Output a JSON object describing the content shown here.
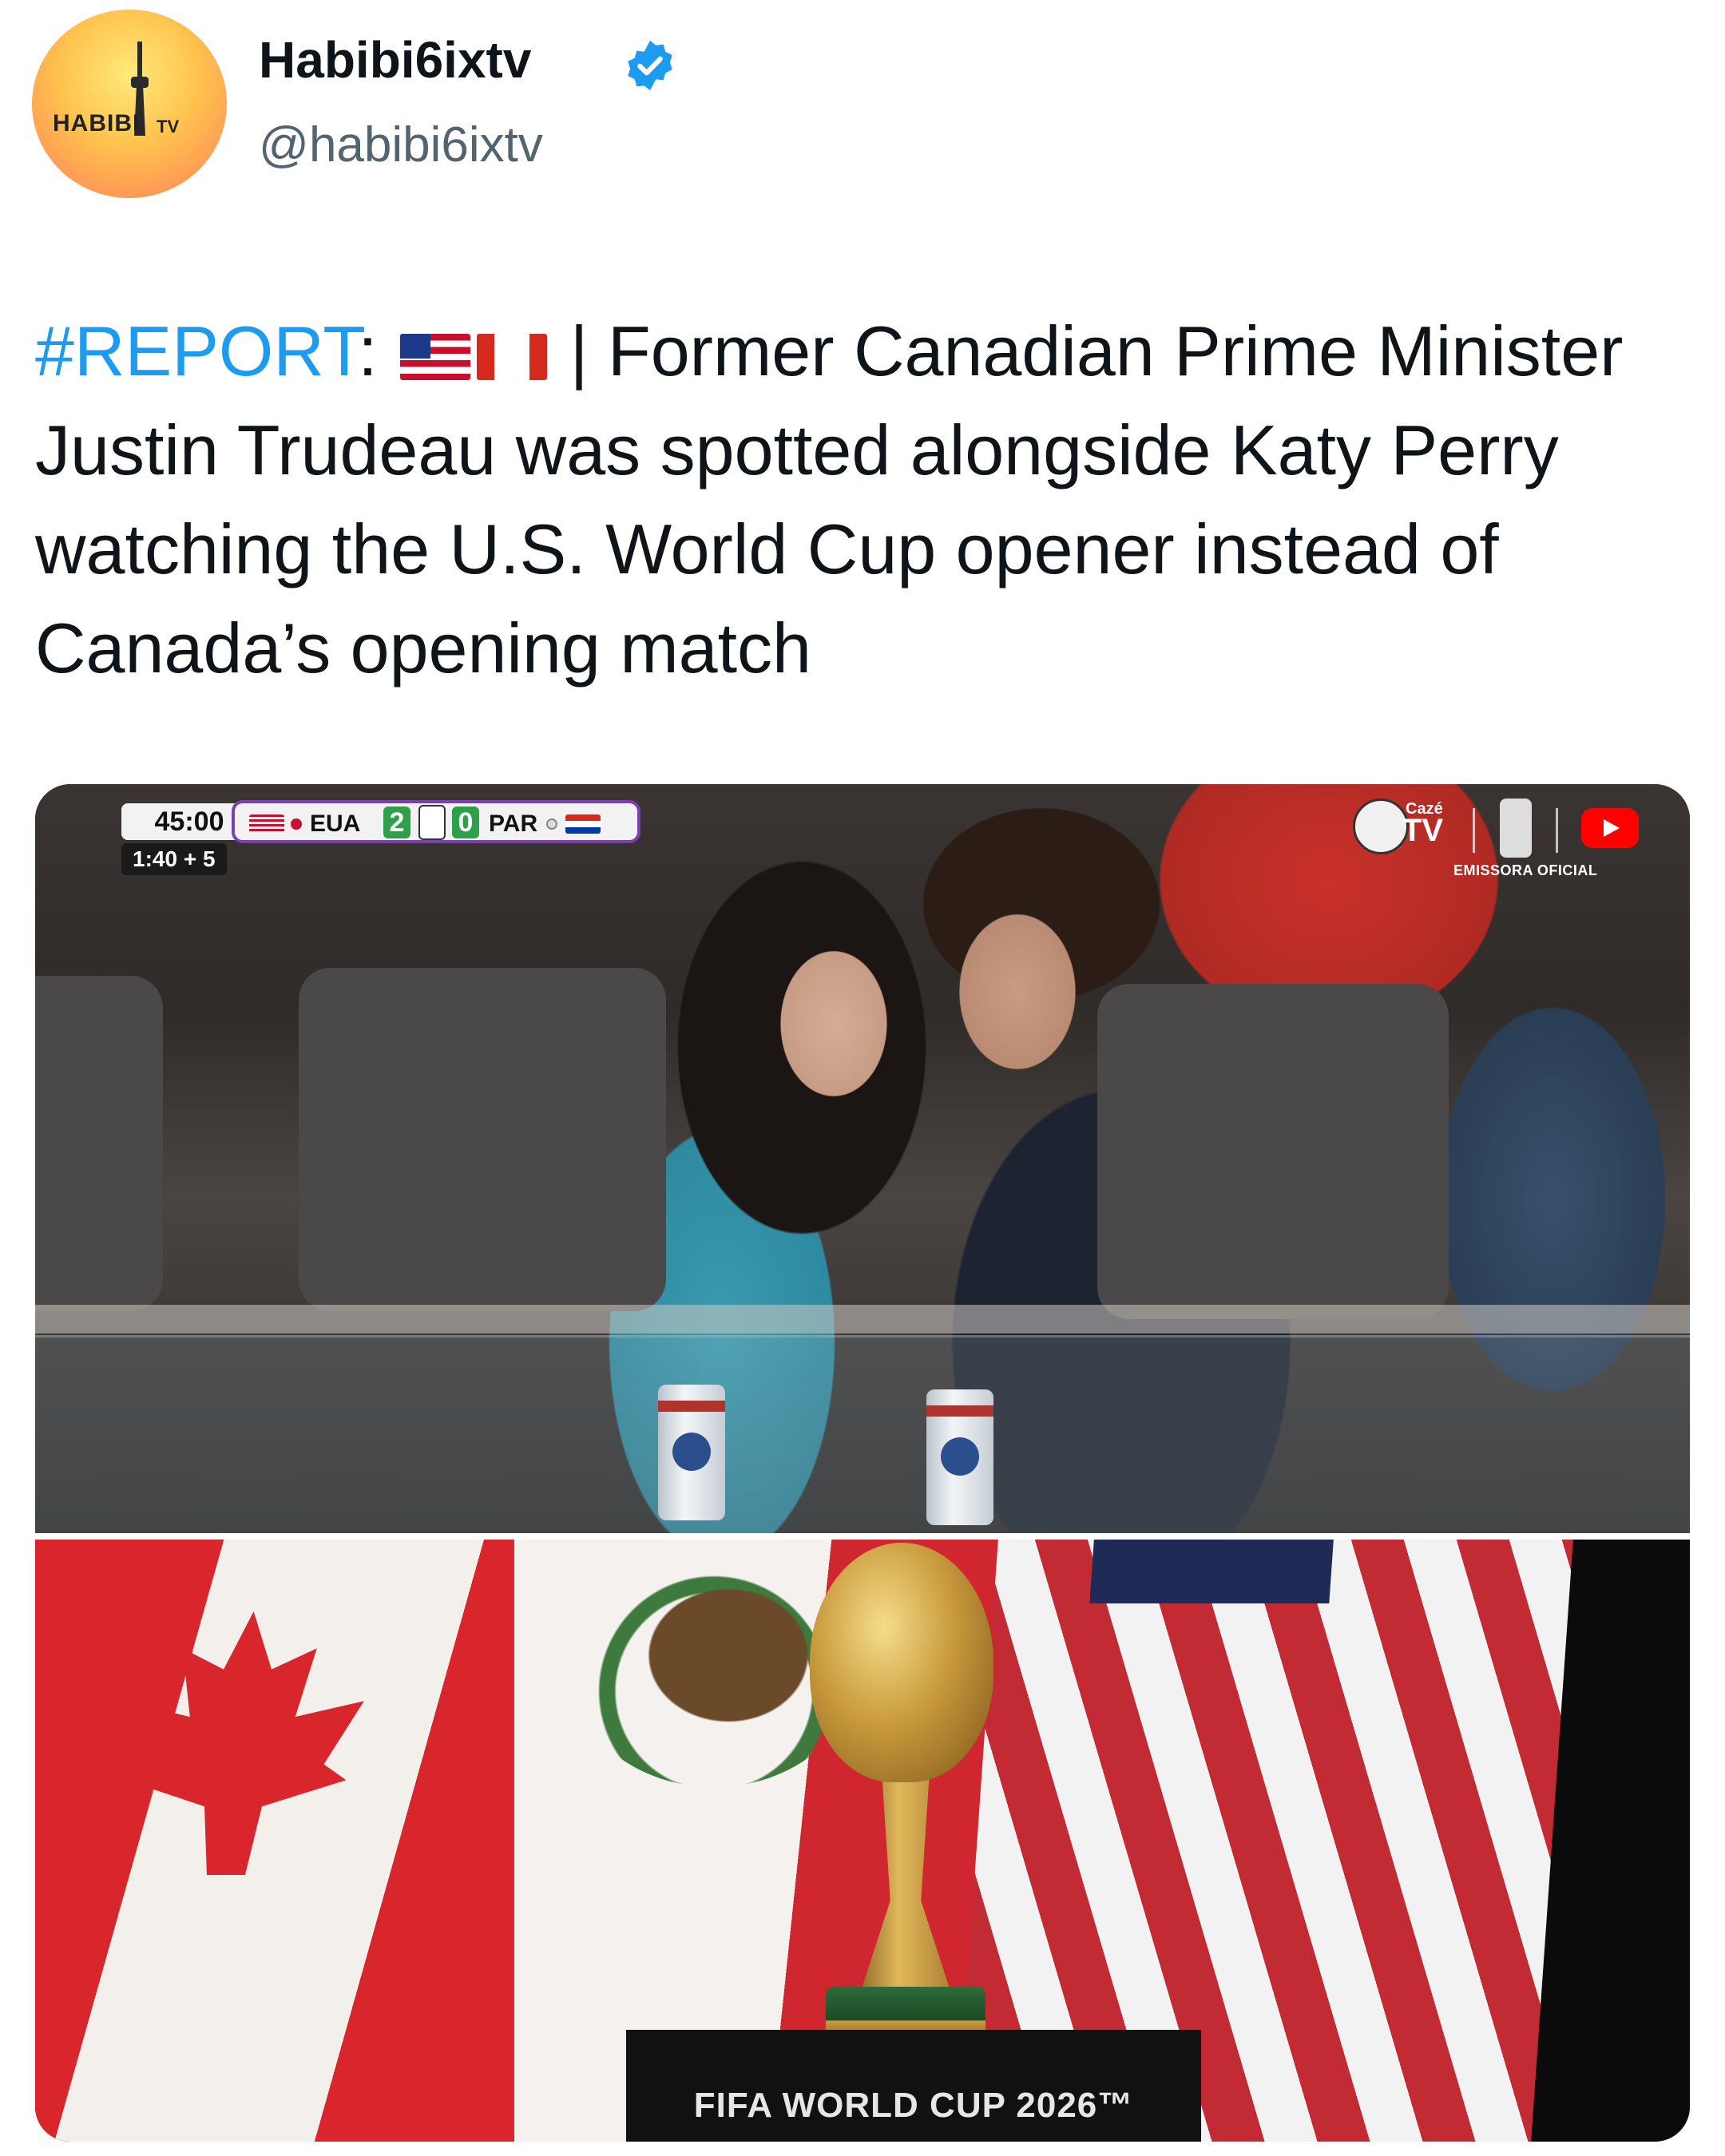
{
  "header": {
    "display_name": "Habibi6ixtv",
    "handle": "@habibi6ixtv",
    "avatar_text_left": "HABIBI",
    "avatar_text_right": "TV",
    "verified_color": "#1d9bf0"
  },
  "tweet": {
    "hashtag": "#REPORT",
    "colon": ":",
    "flags": [
      "us-flag-emoji",
      "canada-flag-emoji"
    ],
    "body": " | Former Canadian Prime Minister Justin Trudeau was spotted alongside Katy Perry watching the U.S. World Cup opener instead of Canada’s opening match"
  },
  "media": {
    "scoreboard": {
      "clock": "45:00",
      "added_time": "1:40 + 5",
      "home_team": "EUA",
      "home_score": "2",
      "away_score": "0",
      "away_team": "PAR",
      "home_color": "#2b3a8a",
      "accent_color": "#7b3fb0"
    },
    "broadcaster": {
      "caze_small": "Cazé",
      "caze_tv": "TV",
      "emissora": "EMISSORA OFICIAL"
    },
    "trophy_plaque": "FIFA WORLD CUP 2026™"
  },
  "colors": {
    "text_primary": "#0f1419",
    "text_secondary": "#536471",
    "link": "#1d9bf0"
  }
}
